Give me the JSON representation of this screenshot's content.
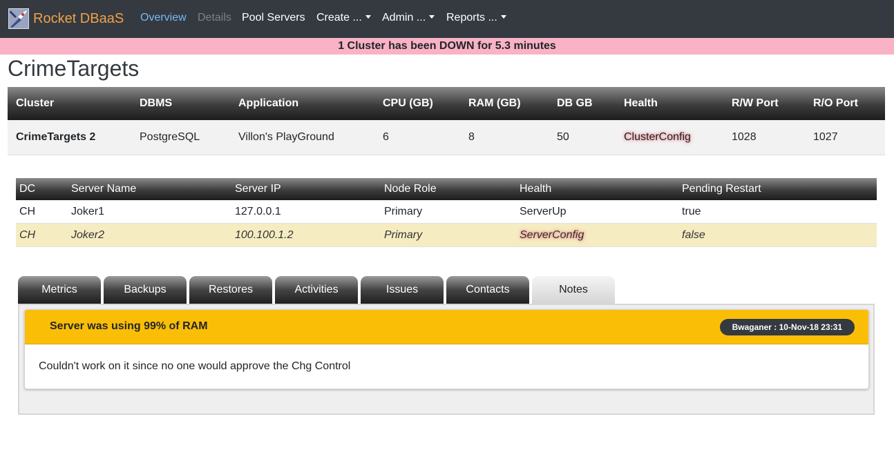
{
  "brand": {
    "name": "Rocket DBaaS"
  },
  "nav": {
    "overview": "Overview",
    "details": "Details",
    "pool_servers": "Pool Servers",
    "create": "Create ...",
    "admin": "Admin ...",
    "reports": "Reports ..."
  },
  "alert": {
    "text": "1 Cluster has been DOWN for 5.3 minutes"
  },
  "page": {
    "title": "CrimeTargets"
  },
  "cluster_table": {
    "headers": [
      "Cluster",
      "DBMS",
      "Application",
      "CPU (GB)",
      "RAM (GB)",
      "DB GB",
      "Health",
      "R/W Port",
      "R/O Port"
    ],
    "row": {
      "cluster": "CrimeTargets 2",
      "dbms": "PostgreSQL",
      "application": "Villon's PlayGround",
      "cpu": "6",
      "ram": "8",
      "db_gb": "50",
      "health": "ClusterConfig",
      "rw_port": "1028",
      "ro_port": "1027"
    }
  },
  "server_table": {
    "headers": [
      "DC",
      "Server Name",
      "Server IP",
      "Node Role",
      "Health",
      "Pending Restart"
    ],
    "rows": [
      {
        "dc": "CH",
        "name": "Joker1",
        "ip": "127.0.0.1",
        "role": "Primary",
        "health": "ServerUp",
        "pending": "true"
      },
      {
        "dc": "CH",
        "name": "Joker2",
        "ip": "100.100.1.2",
        "role": "Primary",
        "health": "ServerConfig",
        "pending": "false"
      }
    ]
  },
  "tabs": [
    "Metrics",
    "Backups",
    "Restores",
    "Activities",
    "Issues",
    "Contacts",
    "Notes"
  ],
  "note": {
    "title": "Server was using 99% of RAM",
    "badge": "Bwaganer : 10-Nov-18 23:31",
    "body": "Couldn't work on it since no one would approve the Chg Control"
  },
  "colors": {
    "navbar": "#343a40",
    "brand": "#f0a04b",
    "alert": "#f9b2c6",
    "note_header": "#fbbe07",
    "warning_row": "#f5ecc2"
  }
}
